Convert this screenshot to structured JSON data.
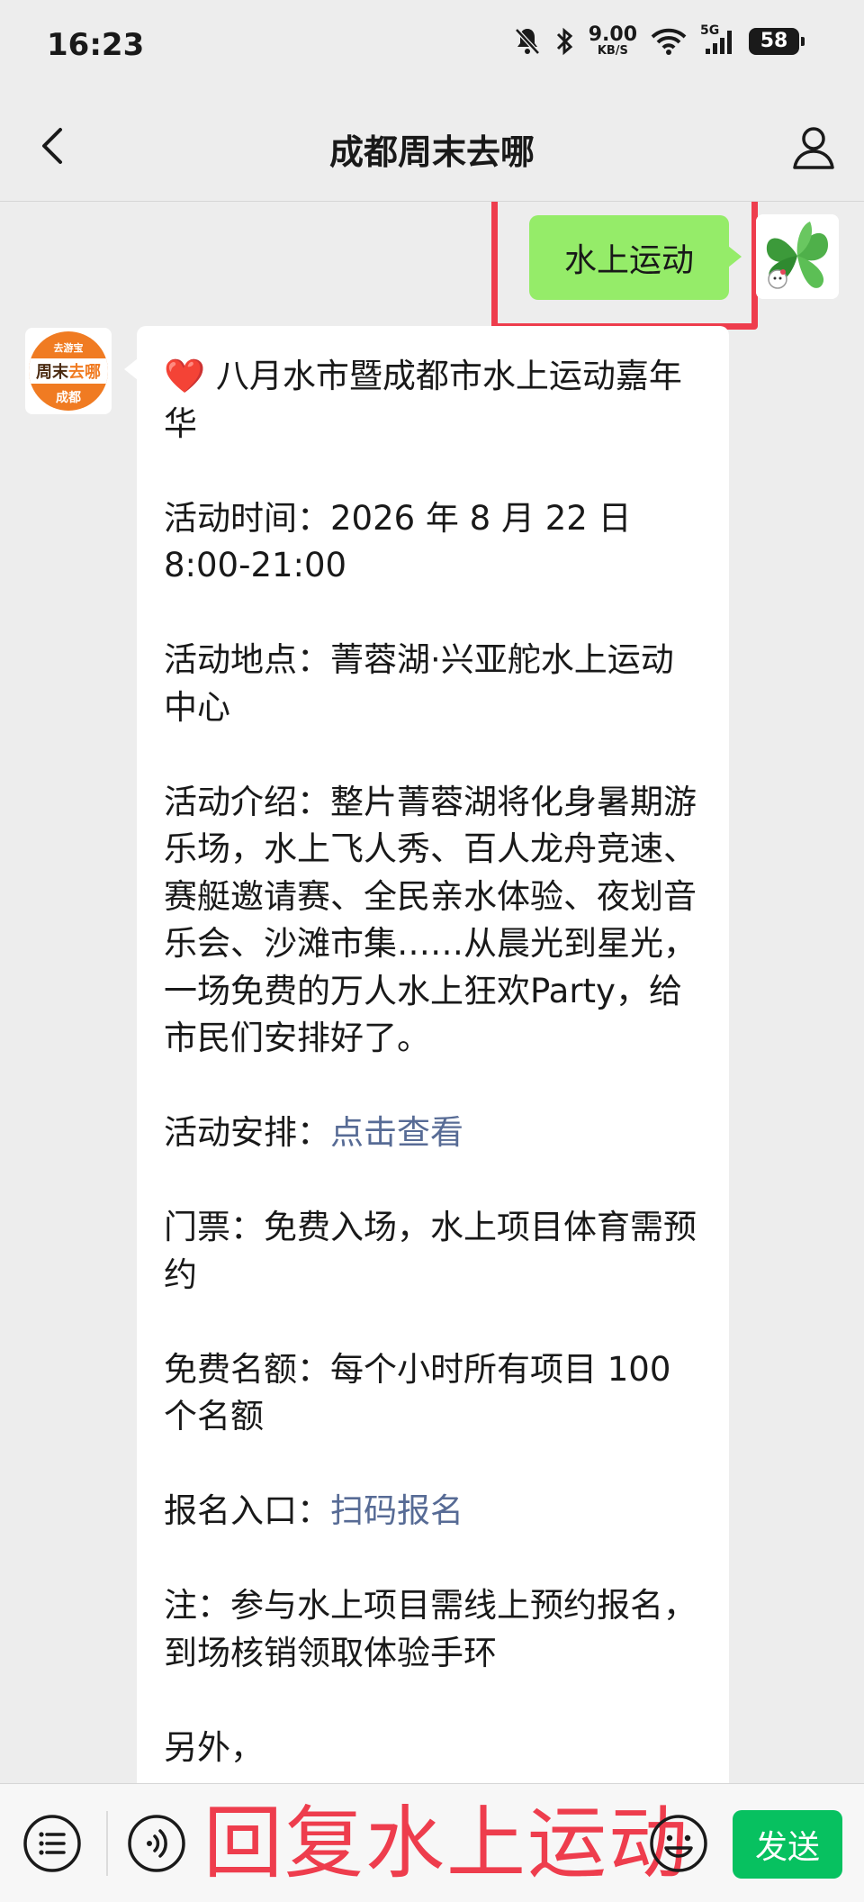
{
  "status_bar": {
    "time": "16:23",
    "net_speed_value": "9.00",
    "net_speed_unit": "KB/S",
    "signal_label": "5G",
    "battery": "58",
    "icons": [
      "bell-muted-icon",
      "bluetooth-icon",
      "wifi-icon",
      "cellular-signal-icon",
      "battery-icon"
    ]
  },
  "nav": {
    "title": "成都周末去哪",
    "icons": [
      "chevron-left-icon",
      "person-icon"
    ]
  },
  "messages": {
    "user_message": "水上运动",
    "bot": {
      "logo_top": "去游宝",
      "logo_mid_a": "周末",
      "logo_mid_b": "去哪",
      "logo_bottom": "成都",
      "heart": "❤️",
      "title": " 八月水市暨成都市水上运动嘉年华",
      "time": "活动时间：2026 年 8 月 22 日 8:00-21:00",
      "location": "活动地点：菁蓉湖·兴亚舵水上运动中心",
      "intro": "活动介绍：整片菁蓉湖将化身暑期游乐场，水上飞人秀、百人龙舟竞速、赛艇邀请赛、全民亲水体验、夜划音乐会、沙滩市集……从晨光到星光，一场免费的万人水上狂欢Party，给市民们安排好了。",
      "schedule_label": "活动安排：",
      "schedule_link": "点击查看",
      "tickets": "门票：免费入场，水上项目体育需预约",
      "quota": "免费名额：每个小时所有项目 100 个名额",
      "signup_label": "报名入口：",
      "signup_link": "扫码报名",
      "note": "注：参与水上项目需线上预约报名，到场核销领取体验手环",
      "extra": "另外，"
    }
  },
  "input_bar": {
    "send_label": "发送",
    "overlay_caption": "回复水上运动",
    "icons": [
      "menu-list-icon",
      "voice-icon",
      "emoji-icon"
    ]
  },
  "colors": {
    "user_bubble": "#95ec69",
    "link": "#576b95",
    "send_button": "#07c160",
    "highlight": "#ee3d4d",
    "background": "#ededed"
  }
}
